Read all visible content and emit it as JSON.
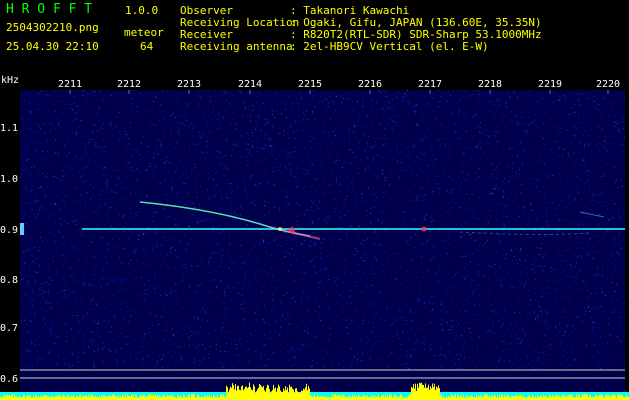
{
  "app": {
    "name": "H R O F F T",
    "version": "1.0.0"
  },
  "file": {
    "name": "2504302210.png",
    "datetime": "25.04.30 22:10"
  },
  "detection": {
    "label": "meteor",
    "count": "64"
  },
  "station": {
    "observer_label": "Observer",
    "observer_value": ": Takanori Kawachi",
    "location_label": "Receiving Location",
    "location_value": ": Ogaki, Gifu, JAPAN (136.60E, 35.35N)",
    "receiver_label": "Receiver",
    "receiver_value": ": R820T2(RTL-SDR) SDR-Sharp 53.1000MHz",
    "antenna_label": "Receiving antenna",
    "antenna_value": ": 2el-HB9CV Vertical (el. E-W)"
  },
  "axes": {
    "y_unit": "kHz",
    "y_ticks": [
      "1.1",
      "1.0",
      "0.9",
      "0.8",
      "0.7",
      "0.6"
    ],
    "x_ticks": [
      "2211",
      "2212",
      "2213",
      "2214",
      "2215",
      "2216",
      "2217",
      "2218",
      "2219",
      "2220"
    ]
  },
  "colors": {
    "background": "#000000",
    "title": "#00ff00",
    "header_text": "#ffff00",
    "tick_text": "#ffffff",
    "spectrogram_bg": "#00004a",
    "carrier": "#33ffff",
    "echo_trace": "#66ffcc",
    "echo_hot": "#ff3366",
    "level_bar": "#ffff00",
    "level_base": "#00ffff"
  }
}
